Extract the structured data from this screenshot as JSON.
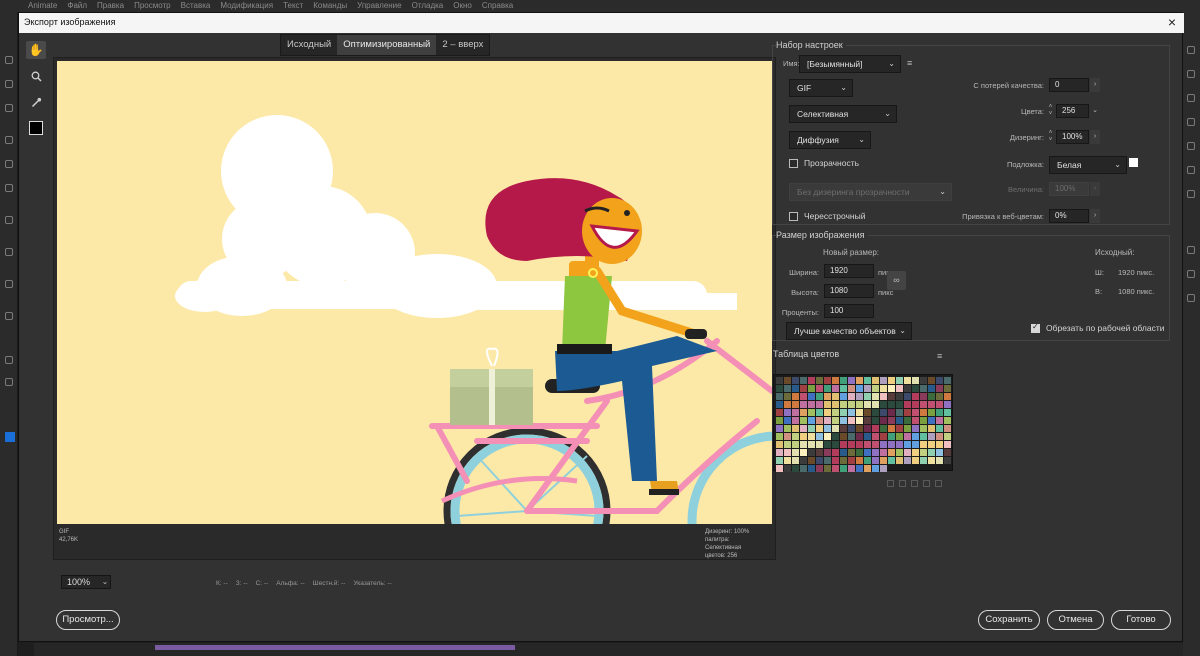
{
  "app": {
    "menu": [
      "Animate",
      "Файл",
      "Правка",
      "Просмотр",
      "Вставка",
      "Модификация",
      "Текст",
      "Команды",
      "Управление",
      "Отладка",
      "Окно",
      "Справка"
    ]
  },
  "dialog": {
    "title": "Экспорт изображения",
    "close_icon": "×"
  },
  "tabs": [
    "Исходный",
    "Оптимизированный",
    "2 – вверх"
  ],
  "preview": {
    "info_left": [
      "GIF",
      "42,76K"
    ],
    "info_right": [
      "Дизеринг: 100%",
      "палитра: Селективная",
      "цветов: 256"
    ]
  },
  "zoom": "100%",
  "readouts": [
    "К: --",
    "З: --",
    "С: --",
    "Альфа: --",
    "Шестн.й: --",
    "Указатель: --"
  ],
  "buttons": {
    "preview": "Просмотр...",
    "save": "Сохранить",
    "cancel": "Отмена",
    "done": "Готово"
  },
  "preset": {
    "group_label": "Набор настроек",
    "name_label": "Имя:",
    "name_value": "[Безымянный]",
    "format": "GIF",
    "palette": "Селективная",
    "dither_algo": "Диффузия",
    "transparency_label": "Прозрачность",
    "transparency_checked": false,
    "transparency_dither": "Без дизеринга прозрачности",
    "interlaced_label": "Чересстрочный",
    "interlaced_checked": false,
    "lossy_label": "С потерей качества:",
    "lossy_value": "0",
    "colors_label": "Цвета:",
    "colors_value": "256",
    "dither_label": "Дизеринг:",
    "dither_value": "100%",
    "matte_label": "Подложка:",
    "matte_value": "Белая",
    "amount_label": "Величина:",
    "amount_value": "100%",
    "websnap_label": "Привязка к веб-цветам:",
    "websnap_value": "0%"
  },
  "image_size": {
    "group_label": "Размер изображения",
    "new_size_label": "Новый размер:",
    "width_label": "Ширина:",
    "width_value": "1920",
    "height_label": "Высота:",
    "height_value": "1080",
    "unit": "пикс",
    "percent_label": "Проценты:",
    "percent_value": "100",
    "quality": "Лучше качество объектов",
    "original_label": "Исходный:",
    "orig_w_label": "Ш:",
    "orig_w_value": "1920 пикс.",
    "orig_h_label": "В:",
    "orig_h_value": "1080 пикс.",
    "clip_label": "Обрезать по рабочей области",
    "clip_checked": true
  },
  "color_table": {
    "label": "Таблица цветов"
  },
  "colors": {
    "sky": "#fde9a7",
    "cloud": "#ffffff",
    "hair": "#b5194a",
    "skin": "#f2a31b",
    "shirt": "#8dc63f",
    "jeans": "#1c5a94",
    "bike": "#f490b5",
    "wheel": "#8fd0dd",
    "box": "#b3c08d"
  }
}
